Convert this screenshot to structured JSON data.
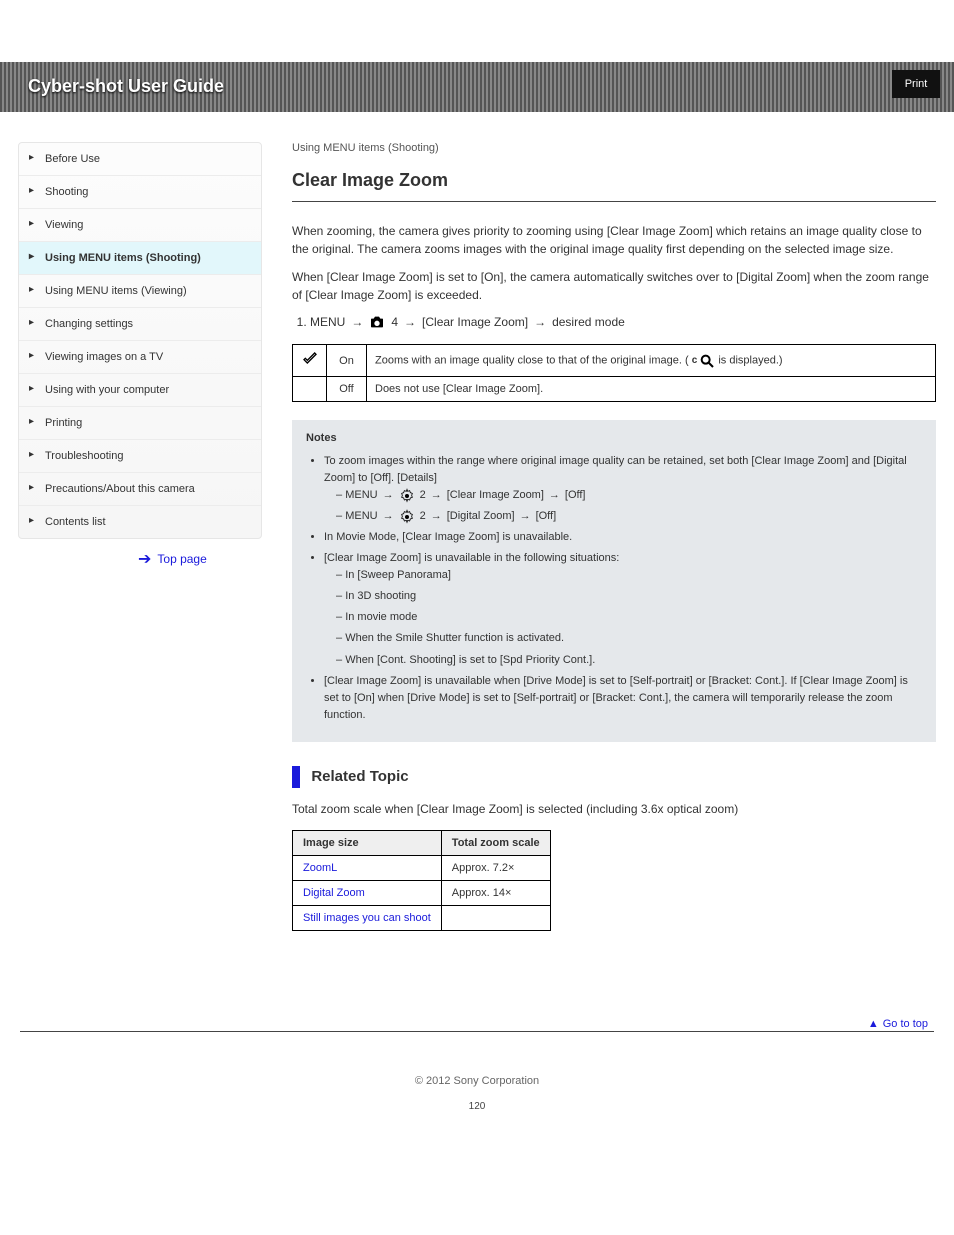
{
  "banner": {
    "title": "Cyber-shot User Guide",
    "box": "Print"
  },
  "sidebar": {
    "items": [
      {
        "label": "Before Use"
      },
      {
        "label": "Shooting"
      },
      {
        "label": "Viewing"
      },
      {
        "label": "Using MENU items (Shooting)"
      },
      {
        "label": "Using MENU items (Viewing)"
      },
      {
        "label": "Changing settings"
      },
      {
        "label": "Viewing images on a TV"
      },
      {
        "label": "Using with your computer"
      },
      {
        "label": "Printing"
      },
      {
        "label": "Troubleshooting"
      },
      {
        "label": "Precautions/About this camera"
      },
      {
        "label": "Contents list"
      }
    ],
    "active_index": 3,
    "top_label": "Top page",
    "breadcrumbs": "Using MENU items (Shooting)"
  },
  "heading": "Clear Image Zoom",
  "intro1": "When zooming, the camera gives priority to zooming using [Clear Image Zoom] which retains an image quality close to the original. The camera zooms images with the original image quality first depending on the selected image size.",
  "intro2": "When [Clear Image Zoom] is set to [On], the camera automatically switches over to [Digital Zoom] when the zoom range of [Clear Image Zoom] is exceeded.",
  "path": {
    "segments": [
      "MENU",
      "4",
      "[Clear Image Zoom]",
      "desired mode"
    ]
  },
  "table1": {
    "rows": [
      {
        "chk": true,
        "label": "On",
        "desc_prefix": "Zooms with an image quality close to that of the original image. (",
        "desc_suffix": " is displayed.)"
      },
      {
        "chk": false,
        "label": "Off",
        "desc_prefix": "Does not use [Clear Image Zoom].",
        "desc_suffix": ""
      }
    ]
  },
  "notes": {
    "title": "Notes",
    "b1_lead": "To zoom images within the range where original image quality can be retained, set both [Clear Image Zoom] and [Digital Zoom] to [Off]. [Details]",
    "b1_s1": {
      "pre": "MENU",
      "mid": "2",
      "post1": "[Clear Image Zoom]",
      "post2": "[Off]"
    },
    "b1_s2": {
      "pre": "MENU",
      "mid": "2",
      "post1": "[Digital Zoom]",
      "post2": "[Off]"
    },
    "b2": "In Movie Mode, [Clear Image Zoom] is unavailable.",
    "b3_lead": "[Clear Image Zoom] is unavailable in the following situations:",
    "b3_items": [
      "In [Sweep Panorama]",
      "In 3D shooting",
      "In movie mode",
      "When the Smile Shutter function is activated.",
      "When [Cont. Shooting] is set to [Spd Priority Cont.]."
    ],
    "b4": "[Clear Image Zoom] is unavailable when [Drive Mode] is set to [Self-portrait] or [Bracket: Cont.]. If [Clear Image Zoom] is set to [On] when [Drive Mode] is set to [Self-portrait] or [Bracket: Cont.], the camera will temporarily release the zoom function."
  },
  "related": {
    "title": "Related Topic",
    "intro": "Total zoom scale when [Clear Image Zoom] is selected (including 3.6x optical zoom)",
    "table": {
      "headers": [
        "Image size",
        "Total zoom scale"
      ],
      "rows": [
        [
          "ZoomL",
          "Approx. 7.2×"
        ],
        [
          "Digital Zoom",
          "Approx. 14×"
        ],
        [
          "Still images you can shoot",
          ""
        ]
      ]
    }
  },
  "go_top": "Go to top",
  "footer": "© 2012 Sony Corporation",
  "page_number": "120"
}
